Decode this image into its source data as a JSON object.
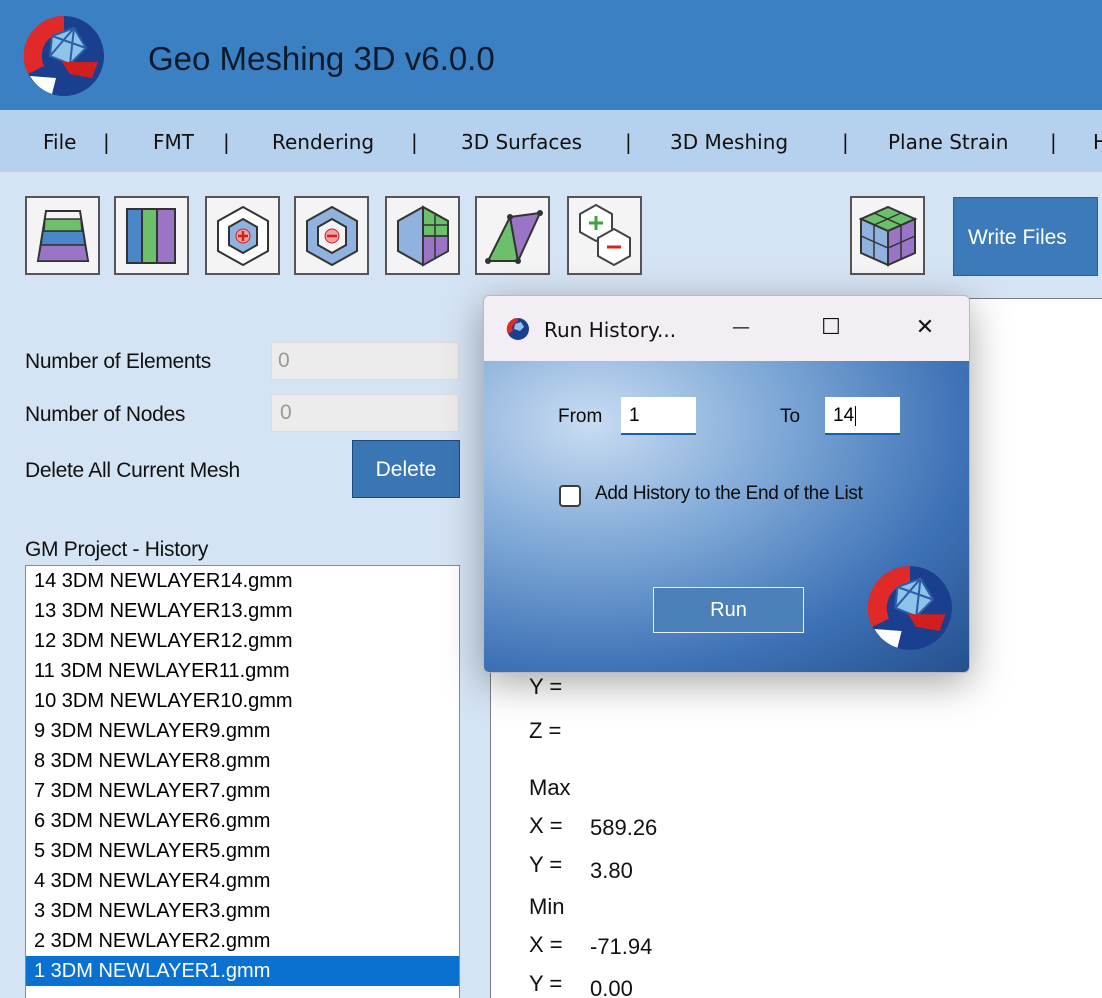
{
  "app": {
    "title": "Geo Meshing 3D v6.0.0",
    "brand_color": "#3b80c2"
  },
  "menu": {
    "items": [
      "File",
      "FMT",
      "Rendering",
      "3D Surfaces",
      "3D Meshing",
      "Plane Strain",
      "H"
    ],
    "separator": "|"
  },
  "toolbar": {
    "tools": [
      {
        "icon": "layered-trapezoid-icon"
      },
      {
        "icon": "vertical-columns-icon"
      },
      {
        "icon": "hexagon-add-icon"
      },
      {
        "icon": "hexagon-remove-icon"
      },
      {
        "icon": "hexagon-grid-icon"
      },
      {
        "icon": "triangles-icon"
      },
      {
        "icon": "hexagon-add-remove-icon"
      },
      {
        "icon": "cube-mesh-icon"
      }
    ],
    "write_files_label": "Write Files"
  },
  "left_panel": {
    "elements_label": "Number of Elements",
    "elements_value": "0",
    "nodes_label": "Number of Nodes",
    "nodes_value": "0",
    "delete_all_label": "Delete All Current Mesh",
    "delete_button": "Delete",
    "history_title": "GM Project - History",
    "history_items": [
      "14 3DM NEWLAYER14.gmm",
      "13 3DM NEWLAYER13.gmm",
      "12 3DM NEWLAYER12.gmm",
      "11 3DM NEWLAYER11.gmm",
      "10 3DM NEWLAYER10.gmm",
      "9 3DM NEWLAYER9.gmm",
      "8 3DM NEWLAYER8.gmm",
      "7 3DM NEWLAYER7.gmm",
      "6 3DM NEWLAYER6.gmm",
      "5 3DM NEWLAYER5.gmm",
      "4 3DM NEWLAYER4.gmm",
      "3 3DM NEWLAYER3.gmm",
      "2 3DM NEWLAYER2.gmm",
      "1 3DM NEWLAYER1.gmm"
    ],
    "selected_item": "1 3DM NEWLAYER1.gmm"
  },
  "coords": {
    "y_label": "Y =",
    "z_label": "Z =",
    "max_label": "Max",
    "max_x_label": "X =",
    "max_x_value": "589.26",
    "max_y_label": "Y =",
    "max_y_value": "3.80",
    "min_label": "Min",
    "min_x_label": "X =",
    "min_x_value": "-71.94",
    "min_y_label": "Y =",
    "min_y_value": "0.00"
  },
  "dialog": {
    "title": "Run History...",
    "minimize_glyph": "—",
    "maximize_glyph": "☐",
    "close_glyph": "✕",
    "from_label": "From",
    "from_value": "1",
    "to_label": "To",
    "to_value": "14",
    "append_label": "Add History to the End of the List",
    "append_checked": false,
    "run_button": "Run"
  }
}
